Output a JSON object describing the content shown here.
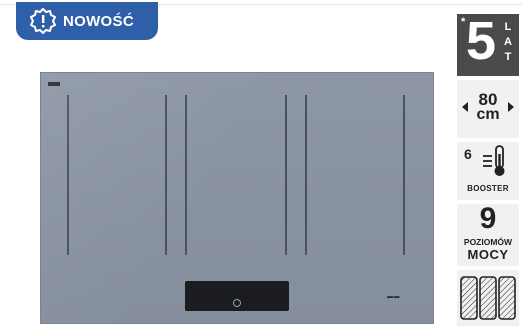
{
  "badge": {
    "icon": "new-burst-icon",
    "label": "NOWOŚĆ",
    "color": "#2f5fa8"
  },
  "product": {
    "image": "induction-hob-grey",
    "colors": {
      "glass": "#8a93a2",
      "lines": "#3f4550",
      "panel": "#1a1c20"
    }
  },
  "features": {
    "warranty": {
      "asterisk": "*",
      "number": "5",
      "letters": [
        "L",
        "A",
        "T"
      ]
    },
    "width": {
      "value": "80",
      "unit": "cm",
      "icon_left": "arrow-left-icon",
      "icon_right": "arrow-right-icon"
    },
    "booster": {
      "number": "6",
      "icon": "thermometer-heat-icon",
      "label": "BOOSTER"
    },
    "power_levels": {
      "number": "9",
      "line1": "POZIOMÓW",
      "line2": "MOCY"
    },
    "zones": {
      "icon": "flex-zones-icon"
    }
  }
}
